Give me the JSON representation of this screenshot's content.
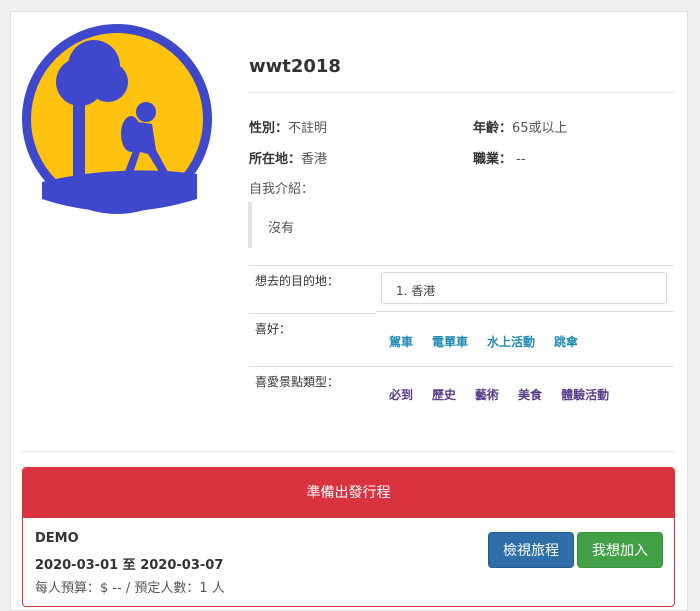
{
  "profile": {
    "username": "wwt2018",
    "gender_label": "性別：",
    "gender_value": "不註明",
    "age_label": "年齡：",
    "age_value": "65或以上",
    "location_label": "所在地：",
    "location_value": "香港",
    "job_label": "職業：",
    "job_value": " --",
    "intro_label": "自我介紹：",
    "intro_text": "沒有"
  },
  "details": {
    "dest_label": "想去的目的地：",
    "dest_value": "1. 香港",
    "hobby_label": "喜好：",
    "hobbies": [
      "駕車",
      "電單車",
      "水上活動",
      "跳傘"
    ],
    "scenic_label": "喜愛景點類型：",
    "scenic_types": [
      "必到",
      "歷史",
      "藝術",
      "美食",
      "體驗活動"
    ]
  },
  "trip_panel": {
    "heading": "準備出發行程",
    "trip_name": "DEMO",
    "dates": "2020-03-01 至 2020-03-07",
    "budget": "每人預算：$ -- / 預定人數：1 人",
    "view_button": "檢視旅程",
    "join_button": "我想加入"
  },
  "colors": {
    "avatar_bg": "#FFC20E",
    "avatar_fg": "#3F48CC",
    "panel_red": "#D9333F",
    "hobby_link": "#1F8AB4",
    "scenic_link": "#5A3D8A",
    "btn_blue": "#2F6EA9",
    "btn_green": "#43A047"
  }
}
